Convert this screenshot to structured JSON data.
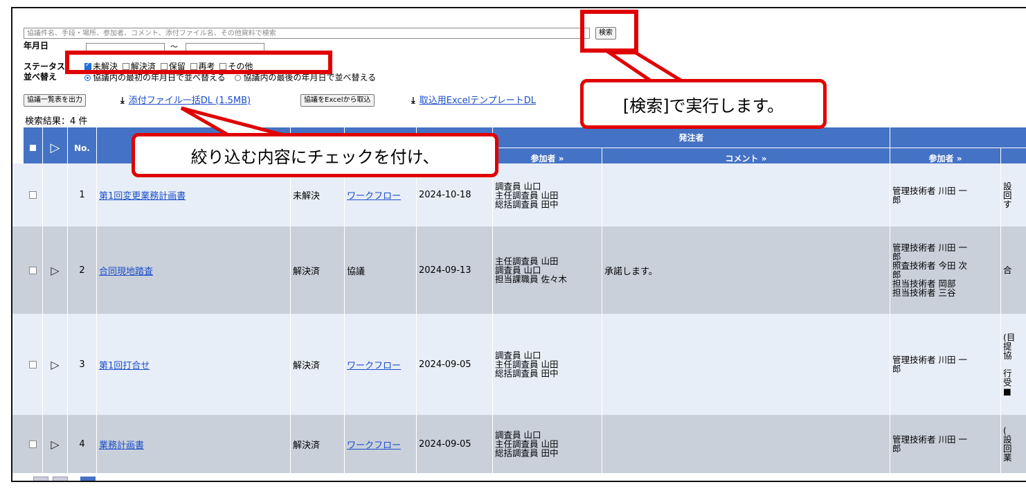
{
  "search": {
    "placeholder": "協議件名、手段・場所、参加者、コメント、添付ファイル名、その他資料で検索",
    "button_label": "検索"
  },
  "filters": {
    "date_label": "年月日",
    "date_separator": "～",
    "status_label": "ステータス",
    "status_options": [
      {
        "label": "未解決",
        "checked": true
      },
      {
        "label": "解決済",
        "checked": false
      },
      {
        "label": "保留",
        "checked": false
      },
      {
        "label": "再考",
        "checked": false
      },
      {
        "label": "その他",
        "checked": false
      }
    ],
    "sort_label": "並べ替え",
    "sort_options": [
      {
        "label": "協議内の最初の年月日で並べ替える",
        "selected": true
      },
      {
        "label": "協議内の最後の年月日で並べ替える",
        "selected": false
      }
    ]
  },
  "actions": {
    "export_list": "協議一覧表を出力",
    "attachments_dl": "添付ファイル一括DL (1.5MB)",
    "import_excel": "協議をExcelから取込",
    "template_dl": "取込用ExcelテンプレートDL"
  },
  "results": {
    "count_text": "検索結果：4 件"
  },
  "table": {
    "headers": {
      "no": "No.",
      "orderer_group": "発注者",
      "orderer_participants": "参加者 »",
      "orderer_comment": "コメント »",
      "contractor_participants": "参加者 »"
    },
    "rows": [
      {
        "no": "1",
        "title": "第1回変更業務計画書",
        "status": "未解決",
        "method": "ワークフロー",
        "method_is_link": true,
        "date": "2024-10-18",
        "orderer_participants": [
          "調査員 山口",
          "主任調査員 山田",
          "総括調査員 田中"
        ],
        "comment": "",
        "contractor_participants": [
          "管理技術者 川田 一",
          "郎"
        ],
        "extra": [
          "設",
          "回",
          "す"
        ],
        "has_expand": false
      },
      {
        "no": "2",
        "title": "合同現地踏査",
        "status": "解決済",
        "method": "協議",
        "method_is_link": false,
        "date": "2024-09-13",
        "orderer_participants": [
          "主任調査員 山田",
          "調査員 山口",
          "担当課職員 佐々木"
        ],
        "comment": "承諾します。",
        "contractor_participants": [
          "管理技術者 川田 一",
          "郎",
          "照査技術者 今田 次",
          "郎",
          "担当技術者 岡部",
          "担当技術者 三谷"
        ],
        "extra": [
          "合"
        ],
        "has_expand": true
      },
      {
        "no": "3",
        "title": "第1回打合せ",
        "status": "解決済",
        "method": "ワークフロー",
        "method_is_link": true,
        "date": "2024-09-05",
        "orderer_participants": [
          "調査員 山口",
          "主任調査員 山田",
          "総括調査員 田中"
        ],
        "comment": "",
        "contractor_participants": [
          "管理技術者 川田 一",
          "郎"
        ],
        "extra": [
          "(目",
          "提",
          "協",
          "",
          "行",
          "受",
          "■"
        ],
        "has_expand": true
      },
      {
        "no": "4",
        "title": "業務計画書",
        "status": "解決済",
        "method": "ワークフロー",
        "method_is_link": true,
        "date": "2024-09-05",
        "orderer_participants": [
          "調査員 山口",
          "主任調査員 山田",
          "総括調査員 田中"
        ],
        "comment": "",
        "contractor_participants": [
          "管理技術者 川田 一",
          "郎"
        ],
        "extra": [
          "(",
          "設",
          "回",
          "業"
        ],
        "has_expand": true
      }
    ]
  },
  "annotations": {
    "search_callout": "[検索]で実行します。",
    "filter_callout": "絞り込む内容にチェックを付け、"
  },
  "colors": {
    "header_blue": "#4472c4",
    "row_light": "#e8eef7",
    "row_dark": "#c9d0da",
    "annotation_red": "#e00000",
    "link_blue": "#1a4dc8"
  }
}
